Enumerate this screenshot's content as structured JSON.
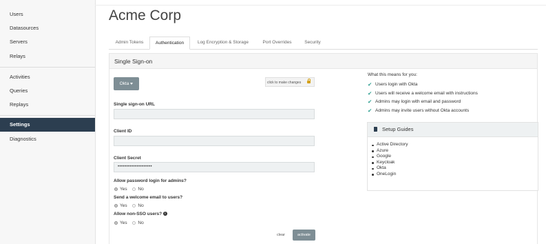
{
  "sidebar": {
    "items": [
      {
        "label": "Users"
      },
      {
        "label": "Datasources"
      },
      {
        "label": "Servers"
      },
      {
        "label": "Relays"
      },
      {
        "label": "Activities"
      },
      {
        "label": "Queries"
      },
      {
        "label": "Replays"
      },
      {
        "label": "Settings",
        "active": true
      },
      {
        "label": "Diagnostics"
      }
    ]
  },
  "page_title": "Acme Corp",
  "tabs": [
    {
      "label": "Admin Tokens"
    },
    {
      "label": "Authentication",
      "active": true
    },
    {
      "label": "Log Encryption & Storage"
    },
    {
      "label": "Port Overrides"
    },
    {
      "label": "Security"
    }
  ],
  "panel": {
    "title": "Single Sign-on"
  },
  "provider_button": {
    "label": "Okta"
  },
  "lock_button": {
    "label": "click to make changes"
  },
  "fields": {
    "sso_url": {
      "label": "Single sign-on URL",
      "value": ""
    },
    "client_id": {
      "label": "Client ID",
      "value": ""
    },
    "client_secret": {
      "label": "Client Secret",
      "value": "••••••••••••••••••••"
    }
  },
  "questions": {
    "password_login": {
      "label": "Allow password login for admins?",
      "yes": "Yes",
      "no": "No",
      "selected": "yes"
    },
    "welcome_email": {
      "label": "Send a welcome email to users?",
      "yes": "Yes",
      "no": "No",
      "selected": "yes"
    },
    "non_sso": {
      "label": "Allow non-SSO users?",
      "yes": "Yes",
      "no": "No",
      "selected": "yes"
    }
  },
  "actions": {
    "clear": "clear",
    "activate": "activate"
  },
  "means": {
    "title": "What this means for you:",
    "items": [
      "Users login with Okta",
      "Users will receive a welcome email with instructions",
      "Admins may login with email and password",
      "Admins may invite users without Okta accounts"
    ]
  },
  "guides": {
    "title": "Setup Guides",
    "items": [
      "Active Directory",
      "Azure",
      "Google",
      "Keycloak",
      "Okta",
      "OneLogin"
    ]
  },
  "colors": {
    "accent": "#2c3e50",
    "button": "#7e8e95",
    "check": "#2a9d8f"
  },
  "icons": {
    "lock": "lock-icon",
    "book": "book-icon",
    "check": "check-icon",
    "info": "info-icon",
    "caret": "caret-down-icon"
  }
}
